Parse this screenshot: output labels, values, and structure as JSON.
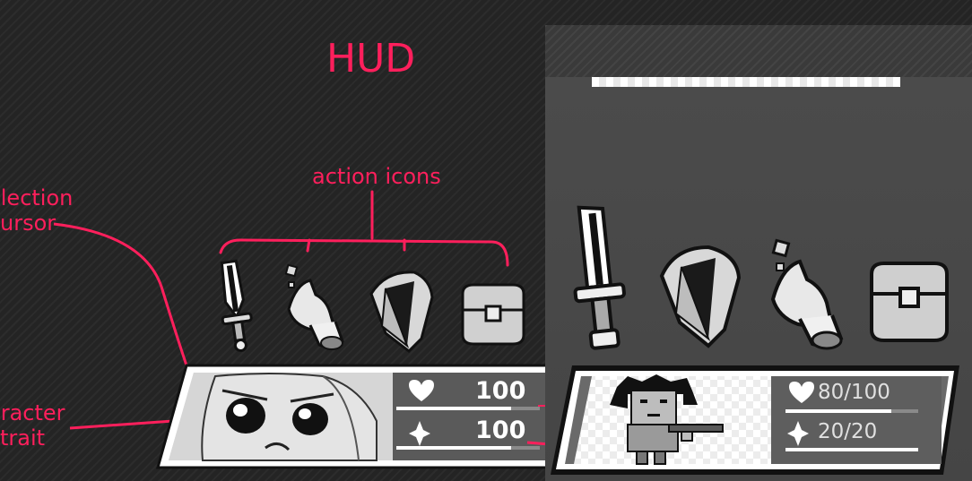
{
  "annotations": {
    "title": "HUD",
    "action_icons": "action icons",
    "selection_cursor_line1": "election",
    "selection_cursor_line2": "ursor",
    "character_portrait_line1": "aracter",
    "character_portrait_line2": "trait"
  },
  "left_hud": {
    "icons": [
      "sword-icon",
      "magic-hand-icon",
      "shield-icon",
      "bag-icon"
    ],
    "hp_value": "100",
    "mp_value": "100",
    "hp_fill": 0.8,
    "mp_fill": 0.8
  },
  "right_hud": {
    "icons": [
      "sword-icon",
      "shield-icon",
      "magic-hand-icon",
      "bag-icon"
    ],
    "hp_text": "80/100",
    "mp_text": "20/20",
    "hp_fill": 0.8,
    "mp_fill": 1.0
  },
  "colors": {
    "annotation": "#ff1f5c",
    "background": "#242424",
    "mockup_background": "#4a4a4a"
  }
}
